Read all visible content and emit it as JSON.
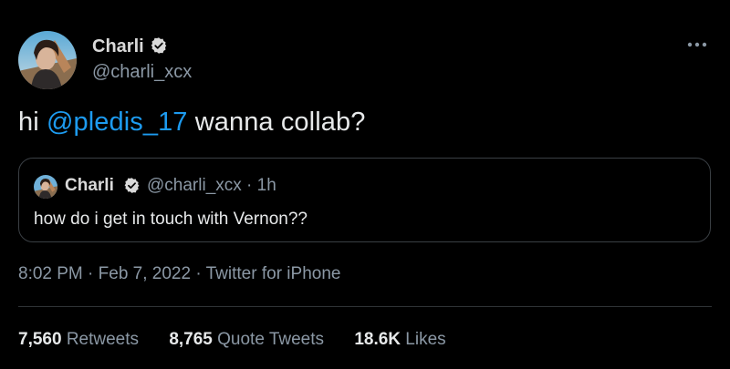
{
  "tweet": {
    "author": {
      "display_name": "Charli",
      "handle": "@charli_xcx",
      "verified": true,
      "avatar_icon": "profile-photo"
    },
    "more_icon": "ellipsis-icon",
    "text": {
      "prefix": "hi ",
      "mention": "@pledis_17",
      "suffix": " wanna collab?"
    },
    "quote": {
      "display_name": "Charli",
      "handle": "@charli_xcx",
      "separator": " · ",
      "age": "1h",
      "text": "how do i get in touch with Vernon??"
    },
    "time": "8:02 PM",
    "date": "Feb 7, 2022",
    "meta_separator": " · ",
    "source": "Twitter for iPhone",
    "stats": [
      {
        "count": "7,560",
        "label": "Retweets"
      },
      {
        "count": "8,765",
        "label": "Quote Tweets"
      },
      {
        "count": "18.6K",
        "label": "Likes"
      }
    ]
  },
  "colors": {
    "background": "#000000",
    "text": "#e7e9ea",
    "secondary_text": "#8b98a5",
    "link": "#1d9bf0",
    "border": "#3a3f44"
  }
}
